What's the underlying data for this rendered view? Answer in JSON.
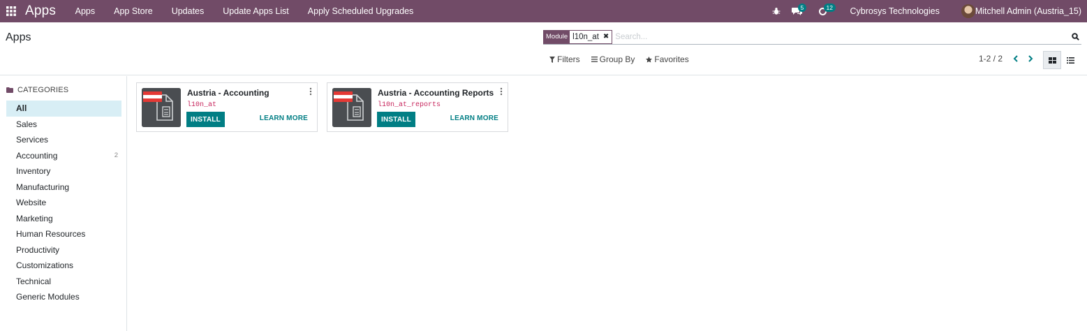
{
  "navbar": {
    "brand": "Apps",
    "menu": [
      "Apps",
      "App Store",
      "Updates",
      "Update Apps List",
      "Apply Scheduled Upgrades"
    ],
    "icons": [
      "apps-grid-icon",
      "bug-icon",
      "chat-icon",
      "activity-clock-icon"
    ],
    "messages_count": "5",
    "activities_count": "12",
    "company": "Cybrosys Technologies",
    "user": "Mitchell Admin (Austria_15)"
  },
  "control": {
    "title": "Apps",
    "facet_label": "Module",
    "facet_value": "l10n_at",
    "search_placeholder": "Search...",
    "filters": "Filters",
    "group_by": "Group By",
    "favorites": "Favorites",
    "pager": "1-2 / 2"
  },
  "sidebar": {
    "heading": "CATEGORIES",
    "items": [
      {
        "label": "All",
        "count": ""
      },
      {
        "label": "Sales",
        "count": ""
      },
      {
        "label": "Services",
        "count": ""
      },
      {
        "label": "Accounting",
        "count": "2"
      },
      {
        "label": "Inventory",
        "count": ""
      },
      {
        "label": "Manufacturing",
        "count": ""
      },
      {
        "label": "Website",
        "count": ""
      },
      {
        "label": "Marketing",
        "count": ""
      },
      {
        "label": "Human Resources",
        "count": ""
      },
      {
        "label": "Productivity",
        "count": ""
      },
      {
        "label": "Customizations",
        "count": ""
      },
      {
        "label": "Technical",
        "count": ""
      },
      {
        "label": "Generic Modules",
        "count": ""
      }
    ]
  },
  "cards": [
    {
      "title": "Austria - Accounting",
      "technical": "l10n_at",
      "install": "INSTALL",
      "learn": "LEARN MORE"
    },
    {
      "title": "Austria - Accounting Reports",
      "technical": "l10n_at_reports",
      "install": "INSTALL",
      "learn": "LEARN MORE"
    }
  ],
  "colors": {
    "brand": "#714B67",
    "accent": "#017e84",
    "flag_red": "#E53935"
  }
}
